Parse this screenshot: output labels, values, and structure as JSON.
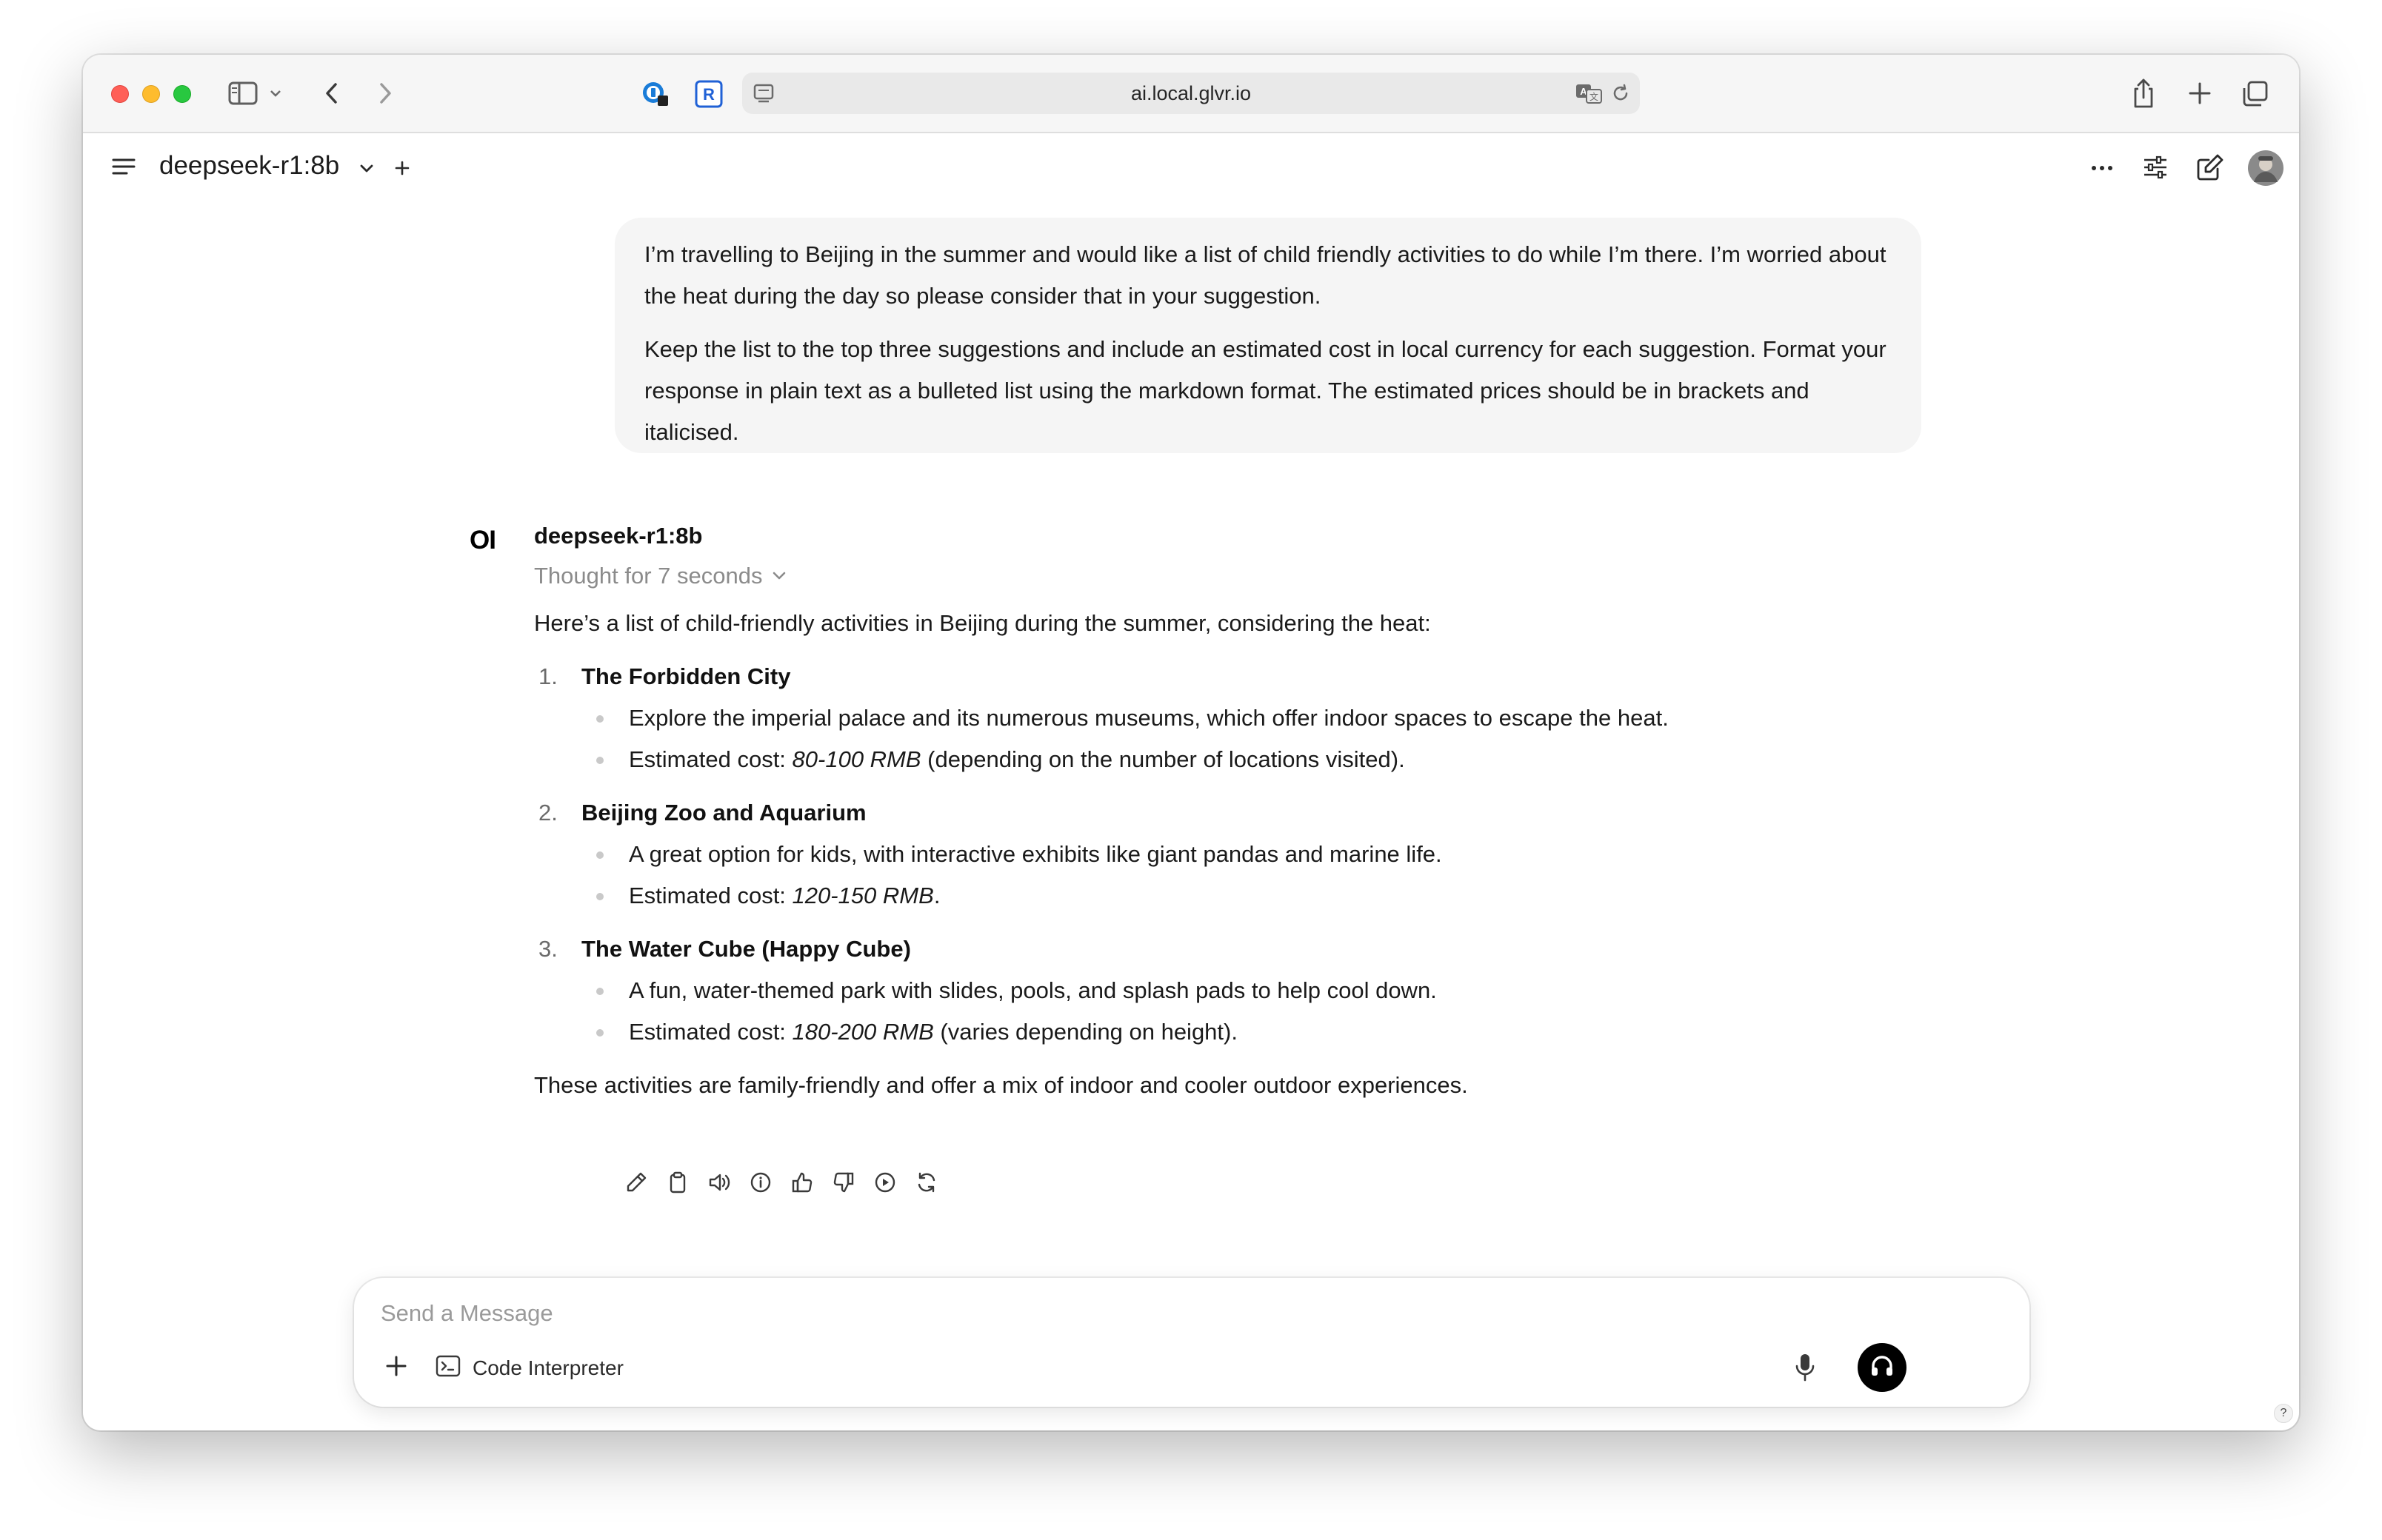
{
  "browser": {
    "url": "ai.local.glvr.io",
    "icons": [
      "sidebar-icon",
      "chevron-down-icon",
      "back-icon",
      "forward-icon",
      "password-manager-icon",
      "extension-r-icon",
      "page-icon",
      "translate-icon",
      "reload-icon",
      "share-icon",
      "new-tab-icon",
      "tab-overview-icon"
    ]
  },
  "header": {
    "model_name": "deepseek-r1:8b",
    "icons": [
      "menu-icon",
      "chevron-down-icon",
      "plus-icon",
      "more-icon",
      "controls-icon",
      "new-chat-icon",
      "avatar"
    ]
  },
  "user_message": {
    "paragraph_1": "I’m travelling to Beijing in the summer and would like a list of child friendly activities to do while I’m there. I’m worried about the heat during the day so please consider that in your suggestion.",
    "paragraph_2": "Keep the list to the top three suggestions and include an estimated cost in local currency for each suggestion. Format your response in plain text as a bulleted list using the markdown format. The estimated prices should be in brackets and italicised."
  },
  "assistant": {
    "logo": "OI",
    "name": "deepseek-r1:8b",
    "thought_label": "Thought for 7 seconds",
    "intro": "Here’s a list of child-friendly activities in Beijing during the summer, considering the heat:",
    "items": [
      {
        "number": "1.",
        "title": "The Forbidden City",
        "description": "Explore the imperial palace and its numerous museums, which offer indoor spaces to escape the heat.",
        "cost_prefix": "Estimated cost: ",
        "cost": "80-100 RMB",
        "cost_suffix": " (depending on the number of locations visited)."
      },
      {
        "number": "2.",
        "title": "Beijing Zoo and Aquarium",
        "description": "A great option for kids, with interactive exhibits like giant pandas and marine life.",
        "cost_prefix": "Estimated cost: ",
        "cost": "120-150 RMB",
        "cost_suffix": "."
      },
      {
        "number": "3.",
        "title": "The Water Cube (Happy Cube)",
        "description": "A fun, water-themed park with slides, pools, and splash pads to help cool down.",
        "cost_prefix": "Estimated cost: ",
        "cost": "180-200 RMB",
        "cost_suffix": " (varies depending on height)."
      }
    ],
    "outro": "These activities are family-friendly and offer a mix of indoor and cooler outdoor experiences.",
    "action_icons": [
      "edit-icon",
      "copy-icon",
      "read-aloud-icon",
      "info-icon",
      "thumbs-up-icon",
      "thumbs-down-icon",
      "continue-icon",
      "regenerate-icon"
    ]
  },
  "composer": {
    "placeholder": "Send a Message",
    "code_interpreter_label": "Code Interpreter",
    "icons": [
      "plus-icon",
      "terminal-icon",
      "microphone-icon",
      "headphones-icon"
    ]
  },
  "help": {
    "label": "?"
  }
}
